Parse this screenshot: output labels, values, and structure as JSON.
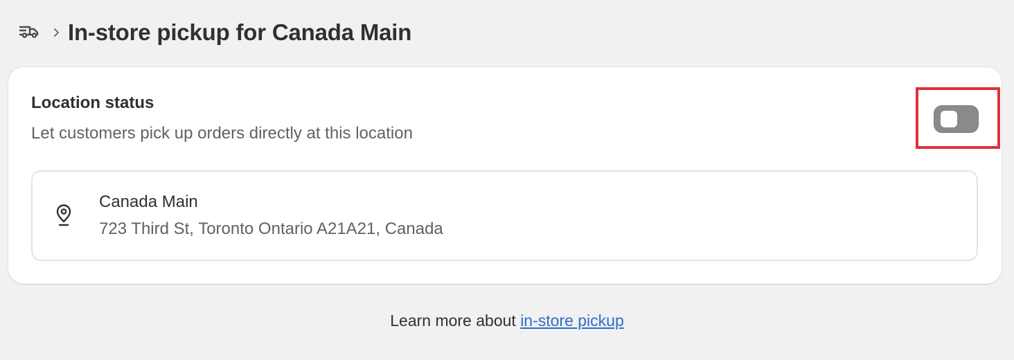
{
  "header": {
    "back_icon": "shipping-truck-icon",
    "chevron_icon": "chevron-right-icon",
    "title": "In-store pickup for Canada Main"
  },
  "status_card": {
    "title": "Location status",
    "description": "Let customers pick up orders directly at this location",
    "toggle": {
      "state": "off",
      "highlight_color": "#e0303d",
      "track_color": "#8a8a8a"
    }
  },
  "location": {
    "icon": "location-pin-icon",
    "name": "Canada Main",
    "address": "723 Third St, Toronto Ontario A21A21, Canada"
  },
  "footer": {
    "prefix": "Learn more about ",
    "link_text": "in-store pickup",
    "link_color": "#2c6ecb"
  }
}
